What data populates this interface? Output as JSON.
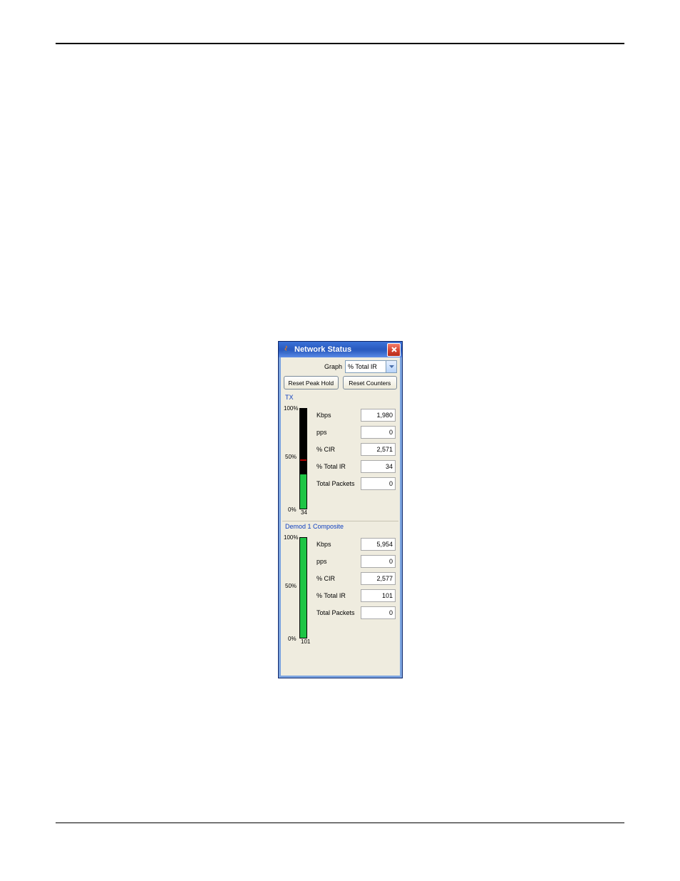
{
  "window": {
    "title": "Network Status",
    "graph_label": "Graph",
    "graph_value": "% Total IR",
    "reset_peak_label": "Reset Peak Hold",
    "reset_counters_label": "Reset Counters"
  },
  "sections": {
    "tx": {
      "title": "TX",
      "gauge_value": 34,
      "gauge_peak": 48,
      "axis": {
        "top": "100%",
        "mid": "50%",
        "bot": "0%"
      },
      "metrics": {
        "kbps_label": "Kbps",
        "kbps_value": "1,980",
        "pps_label": "pps",
        "pps_value": "0",
        "cir_label": "% CIR",
        "cir_value": "2,571",
        "tir_label": "% Total IR",
        "tir_value": "34",
        "tp_label": "Total Packets",
        "tp_value": "0"
      }
    },
    "demod": {
      "title": "Demod 1 Composite",
      "gauge_value": 101,
      "gauge_peak": null,
      "axis": {
        "top": "100%",
        "mid": "50%",
        "bot": "0%"
      },
      "metrics": {
        "kbps_label": "Kbps",
        "kbps_value": "5,954",
        "pps_label": "pps",
        "pps_value": "0",
        "cir_label": "% CIR",
        "cir_value": "2,577",
        "tir_label": "% Total IR",
        "tir_value": "101",
        "tp_label": "Total Packets",
        "tp_value": "0"
      }
    }
  },
  "chart_data": [
    {
      "type": "bar",
      "title": "TX — % Total IR",
      "categories": [
        "TX"
      ],
      "values": [
        34
      ],
      "peak": 48,
      "ylabel": "% Total IR",
      "ylim": [
        0,
        100
      ],
      "xlabel": ""
    },
    {
      "type": "bar",
      "title": "Demod 1 Composite — % Total IR",
      "categories": [
        "Demod 1 Composite"
      ],
      "values": [
        101
      ],
      "ylabel": "% Total IR",
      "ylim": [
        0,
        100
      ],
      "xlabel": ""
    }
  ]
}
